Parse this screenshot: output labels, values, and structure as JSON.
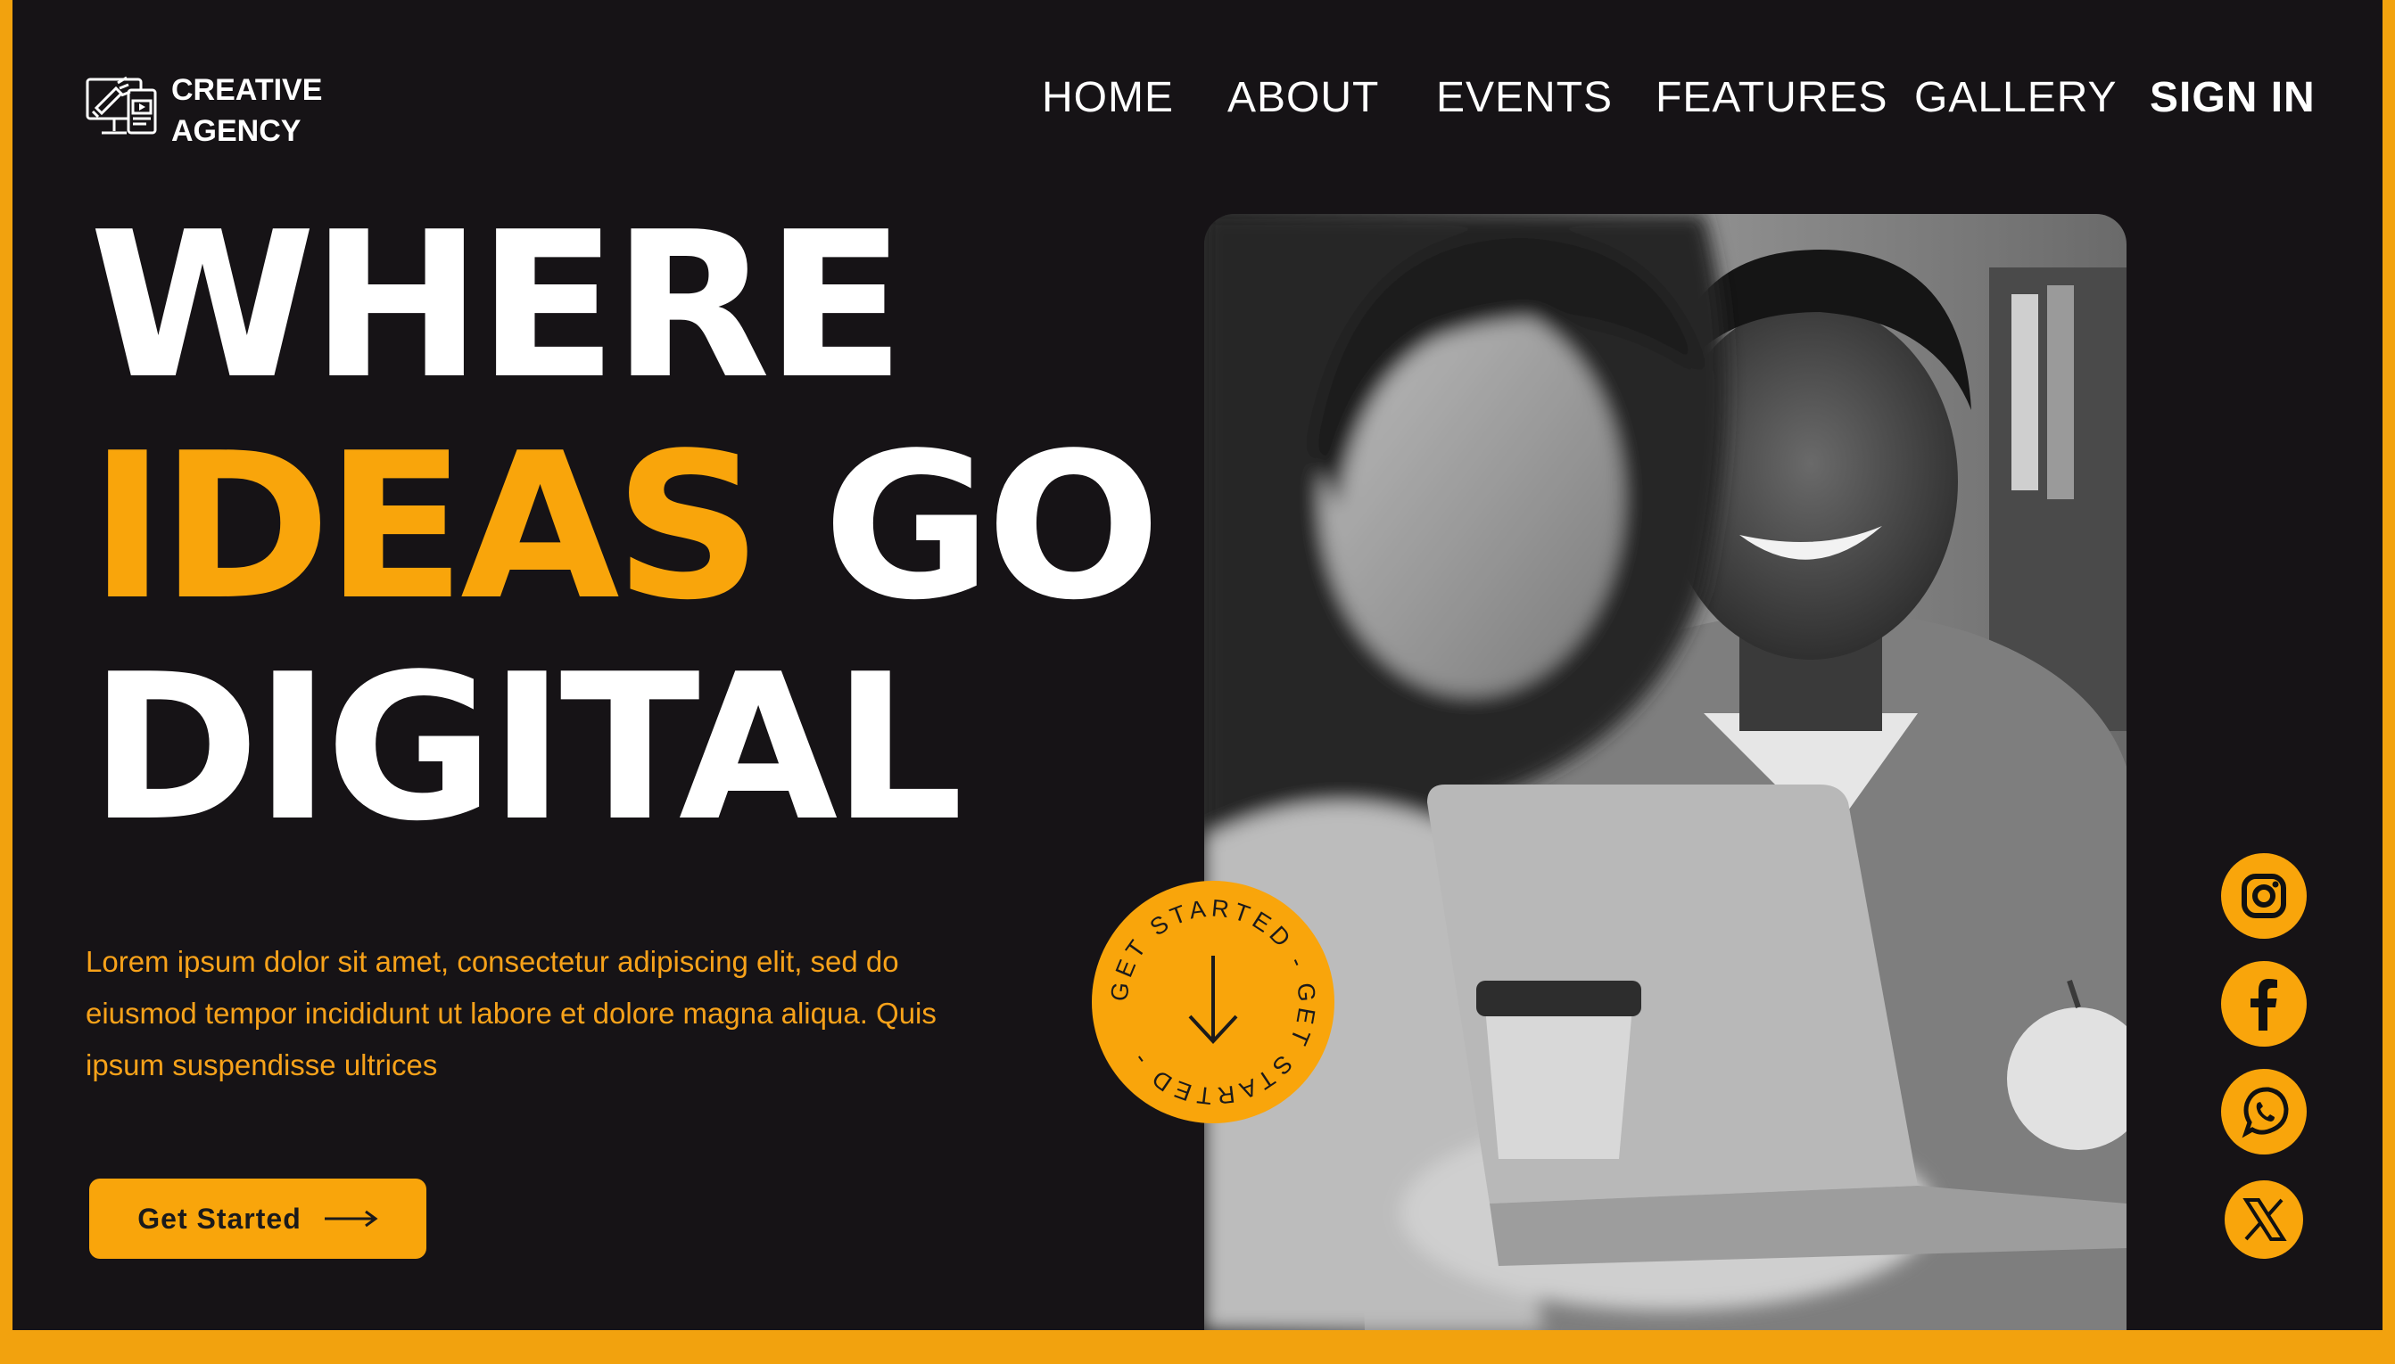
{
  "brand": {
    "line1": "CREATIVE",
    "line2": "AGENCY",
    "icon": "monitor-megaphone-icon"
  },
  "nav": {
    "items": [
      {
        "label": "HOME"
      },
      {
        "label": "ABOUT"
      },
      {
        "label": "EVENTS"
      },
      {
        "label": "FEATURES"
      },
      {
        "label": "GALLERY"
      },
      {
        "label": "SIGN IN"
      }
    ]
  },
  "hero": {
    "line1": "WHERE",
    "line2_accent": "IDEAS",
    "line2_rest": "GO",
    "line3": "DIGITAL",
    "description": "Lorem ipsum dolor sit amet, consectetur adipiscing elit, sed do eiusmod tempor incididunt ut labore et dolore magna aliqua. Quis ipsum suspendisse ultrices",
    "cta_label": "Get Started"
  },
  "badge": {
    "ring_text": "GET STARTED - GET STARTED - ",
    "icon": "arrow-down-icon"
  },
  "social": [
    {
      "icon": "instagram-icon"
    },
    {
      "icon": "facebook-icon"
    },
    {
      "icon": "whatsapp-icon"
    },
    {
      "icon": "x-twitter-icon"
    }
  ],
  "colors": {
    "accent": "#f9a50b",
    "background": "#161316",
    "text": "#ffffff"
  }
}
